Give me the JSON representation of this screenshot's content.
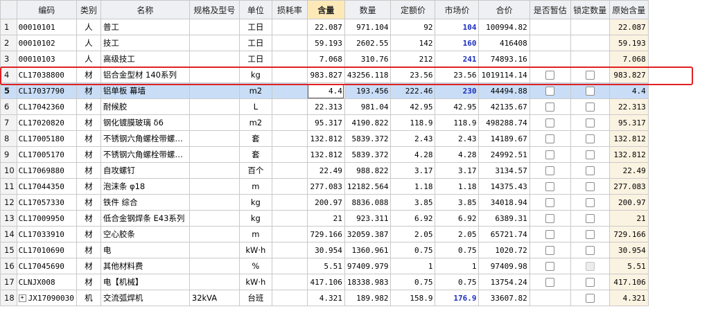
{
  "columns": [
    {
      "key": "idx",
      "label": ""
    },
    {
      "key": "code",
      "label": "编码"
    },
    {
      "key": "cat",
      "label": "类别"
    },
    {
      "key": "name",
      "label": "名称"
    },
    {
      "key": "spec",
      "label": "规格及型号"
    },
    {
      "key": "unit",
      "label": "单位"
    },
    {
      "key": "loss",
      "label": "损耗率"
    },
    {
      "key": "qty",
      "label": "含量"
    },
    {
      "key": "amount",
      "label": "数量"
    },
    {
      "key": "quota",
      "label": "定额价"
    },
    {
      "key": "market",
      "label": "市场价"
    },
    {
      "key": "total",
      "label": "合价"
    },
    {
      "key": "est",
      "label": "是否暂估"
    },
    {
      "key": "lock",
      "label": "锁定数量"
    },
    {
      "key": "orig",
      "label": "原始含量"
    }
  ],
  "rows": [
    {
      "idx": "1",
      "code": "00010101",
      "cat": "人",
      "name": "普工",
      "spec": "",
      "unit": "工日",
      "loss": "",
      "qty": "22.087",
      "amount": "971.104",
      "quota": "92",
      "market": "104",
      "market_bold": true,
      "total": "100994.82",
      "est": false,
      "lock": false,
      "orig": "22.087"
    },
    {
      "idx": "2",
      "code": "00010102",
      "cat": "人",
      "name": "技工",
      "spec": "",
      "unit": "工日",
      "loss": "",
      "qty": "59.193",
      "amount": "2602.55",
      "quota": "142",
      "market": "160",
      "market_bold": true,
      "total": "416408",
      "est": false,
      "lock": false,
      "orig": "59.193"
    },
    {
      "idx": "3",
      "code": "00010103",
      "cat": "人",
      "name": "高级技工",
      "spec": "",
      "unit": "工日",
      "loss": "",
      "qty": "7.068",
      "amount": "310.76",
      "quota": "212",
      "market": "241",
      "market_bold": true,
      "total": "74893.16",
      "est": false,
      "lock": false,
      "orig": "7.068"
    },
    {
      "idx": "4",
      "code": "CL17038800",
      "cat": "材",
      "name": "铝合金型材 140系列",
      "spec": "",
      "unit": "kg",
      "loss": "",
      "qty": "983.827",
      "amount": "43256.118",
      "quota": "23.56",
      "market": "23.56",
      "market_bold": false,
      "total": "1019114.14",
      "est": true,
      "lock": true,
      "orig": "983.827"
    },
    {
      "idx": "5",
      "code": "CL17037790",
      "cat": "材",
      "name": "铝单板 幕墙",
      "spec": "",
      "unit": "m2",
      "loss": "",
      "qty": "4.4",
      "amount": "193.456",
      "quota": "222.46",
      "market": "230",
      "market_bold": true,
      "total": "44494.88",
      "est": true,
      "lock": true,
      "orig": "4.4",
      "selected": true
    },
    {
      "idx": "6",
      "code": "CL17042360",
      "cat": "材",
      "name": "耐候胶",
      "spec": "",
      "unit": "L",
      "loss": "",
      "qty": "22.313",
      "amount": "981.04",
      "quota": "42.95",
      "market": "42.95",
      "market_bold": false,
      "total": "42135.67",
      "est": true,
      "lock": true,
      "orig": "22.313"
    },
    {
      "idx": "7",
      "code": "CL17020820",
      "cat": "材",
      "name": "钢化镀膜玻璃 δ6",
      "spec": "",
      "unit": "m2",
      "loss": "",
      "qty": "95.317",
      "amount": "4190.822",
      "quota": "118.9",
      "market": "118.9",
      "market_bold": false,
      "total": "498288.74",
      "est": true,
      "lock": true,
      "orig": "95.317"
    },
    {
      "idx": "8",
      "code": "CL17005180",
      "cat": "材",
      "name": "不锈钢六角螺栓带螺…",
      "spec": "",
      "unit": "套",
      "loss": "",
      "qty": "132.812",
      "amount": "5839.372",
      "quota": "2.43",
      "market": "2.43",
      "market_bold": false,
      "total": "14189.67",
      "est": true,
      "lock": true,
      "orig": "132.812"
    },
    {
      "idx": "9",
      "code": "CL17005170",
      "cat": "材",
      "name": "不锈钢六角螺栓带螺…",
      "spec": "",
      "unit": "套",
      "loss": "",
      "qty": "132.812",
      "amount": "5839.372",
      "quota": "4.28",
      "market": "4.28",
      "market_bold": false,
      "total": "24992.51",
      "est": true,
      "lock": true,
      "orig": "132.812"
    },
    {
      "idx": "10",
      "code": "CL17069880",
      "cat": "材",
      "name": "自攻螺钉",
      "spec": "",
      "unit": "百个",
      "loss": "",
      "qty": "22.49",
      "amount": "988.822",
      "quota": "3.17",
      "market": "3.17",
      "market_bold": false,
      "total": "3134.57",
      "est": true,
      "lock": true,
      "orig": "22.49"
    },
    {
      "idx": "11",
      "code": "CL17044350",
      "cat": "材",
      "name": "泡沫条 φ18",
      "spec": "",
      "unit": "m",
      "loss": "",
      "qty": "277.083",
      "amount": "12182.564",
      "quota": "1.18",
      "market": "1.18",
      "market_bold": false,
      "total": "14375.43",
      "est": true,
      "lock": true,
      "orig": "277.083"
    },
    {
      "idx": "12",
      "code": "CL17057330",
      "cat": "材",
      "name": "铁件 综合",
      "spec": "",
      "unit": "kg",
      "loss": "",
      "qty": "200.97",
      "amount": "8836.088",
      "quota": "3.85",
      "market": "3.85",
      "market_bold": false,
      "total": "34018.94",
      "est": true,
      "lock": true,
      "orig": "200.97"
    },
    {
      "idx": "13",
      "code": "CL17009950",
      "cat": "材",
      "name": "低合金钢焊条 E43系列",
      "spec": "",
      "unit": "kg",
      "loss": "",
      "qty": "21",
      "amount": "923.311",
      "quota": "6.92",
      "market": "6.92",
      "market_bold": false,
      "total": "6389.31",
      "est": true,
      "lock": true,
      "orig": "21"
    },
    {
      "idx": "14",
      "code": "CL17033910",
      "cat": "材",
      "name": "空心胶条",
      "spec": "",
      "unit": "m",
      "loss": "",
      "qty": "729.166",
      "amount": "32059.387",
      "quota": "2.05",
      "market": "2.05",
      "market_bold": false,
      "total": "65721.74",
      "est": true,
      "lock": true,
      "orig": "729.166"
    },
    {
      "idx": "15",
      "code": "CL17010690",
      "cat": "材",
      "name": "电",
      "spec": "",
      "unit": "kW·h",
      "loss": "",
      "qty": "30.954",
      "amount": "1360.961",
      "quota": "0.75",
      "market": "0.75",
      "market_bold": false,
      "total": "1020.72",
      "est": true,
      "lock": true,
      "orig": "30.954"
    },
    {
      "idx": "16",
      "code": "CL17045690",
      "cat": "材",
      "name": "其他材料费",
      "spec": "",
      "unit": "%",
      "loss": "",
      "qty": "5.51",
      "amount": "97409.979",
      "quota": "1",
      "market": "1",
      "market_bold": false,
      "total": "97409.98",
      "est": true,
      "lock": "disabled",
      "orig": "5.51"
    },
    {
      "idx": "17",
      "code": "CLNJX008",
      "cat": "材",
      "name": "电【机械】",
      "spec": "",
      "unit": "kW·h",
      "loss": "",
      "qty": "417.106",
      "amount": "18338.983",
      "quota": "0.75",
      "market": "0.75",
      "market_bold": false,
      "total": "13754.24",
      "est": true,
      "lock": true,
      "orig": "417.106"
    },
    {
      "idx": "18",
      "code": "JX17090030",
      "cat": "机",
      "name": "交流弧焊机",
      "spec": "32kVA",
      "unit": "台班",
      "loss": "",
      "qty": "4.321",
      "amount": "189.982",
      "quota": "158.9",
      "market": "176.9",
      "market_bold": true,
      "total": "33607.82",
      "est": false,
      "lock": true,
      "orig": "4.321",
      "expandable": true
    }
  ]
}
